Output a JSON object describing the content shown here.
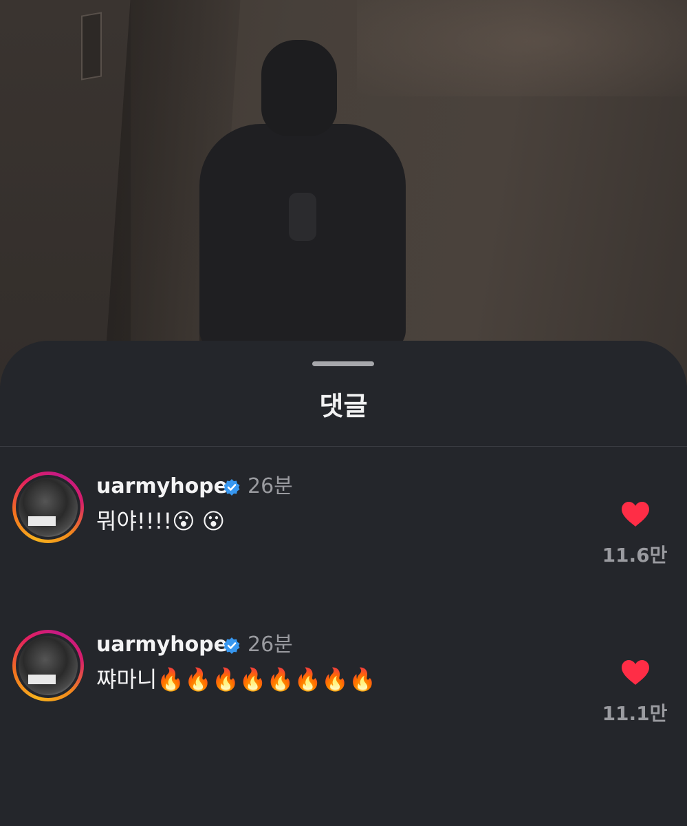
{
  "sheet": {
    "title": "댓글"
  },
  "comments": [
    {
      "username": "uarmyhope",
      "verified": true,
      "time": "26분",
      "text": "뭐야!!!!😮 😮",
      "likes": "11.6만",
      "liked": true
    },
    {
      "username": "uarmyhope",
      "verified": true,
      "time": "26분",
      "text": "쨔마니🔥🔥🔥🔥🔥🔥🔥🔥",
      "likes": "11.1만",
      "liked": true
    }
  ],
  "colors": {
    "background": "#24262b",
    "heart": "#ff2d46",
    "verified": "#3797f0"
  }
}
